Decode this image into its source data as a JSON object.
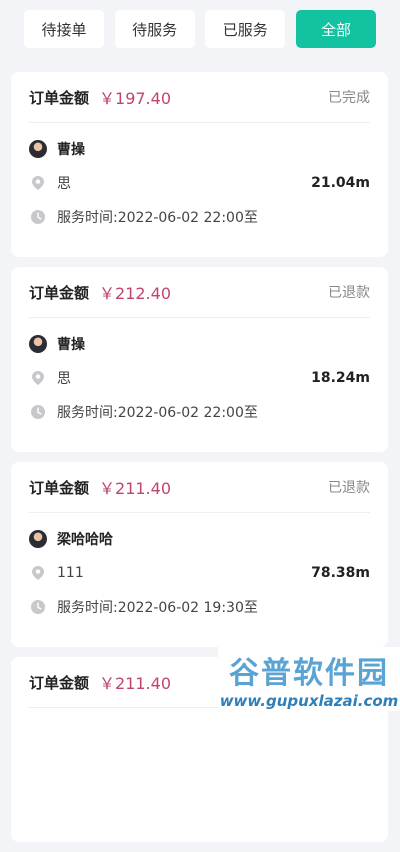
{
  "tabs": [
    {
      "label": "待接单",
      "active": false
    },
    {
      "label": "待服务",
      "active": false
    },
    {
      "label": "已服务",
      "active": false
    },
    {
      "label": "全部",
      "active": true
    }
  ],
  "orders": [
    {
      "amount_label": "订单金额",
      "amount": "￥197.40",
      "status": "已完成",
      "user": "曹操",
      "address": "思",
      "distance": "21.04m",
      "time": "服务时间:2022-06-02 22:00至"
    },
    {
      "amount_label": "订单金额",
      "amount": "￥212.40",
      "status": "已退款",
      "user": "曹操",
      "address": "思",
      "distance": "18.24m",
      "time": "服务时间:2022-06-02 22:00至"
    },
    {
      "amount_label": "订单金额",
      "amount": "￥211.40",
      "status": "已退款",
      "user": "梁哈哈哈",
      "address": "111",
      "distance": "78.38m",
      "time": "服务时间:2022-06-02 19:30至"
    },
    {
      "amount_label": "订单金额",
      "amount": "￥211.40",
      "status": "",
      "user": "",
      "address": "",
      "distance": "",
      "time": ""
    }
  ],
  "watermark": {
    "title": "谷普软件园",
    "url": "www.gupuxlazai.com"
  },
  "colors": {
    "accent": "#12c2a0",
    "price": "#c0456d",
    "background": "#f3f4f8"
  }
}
